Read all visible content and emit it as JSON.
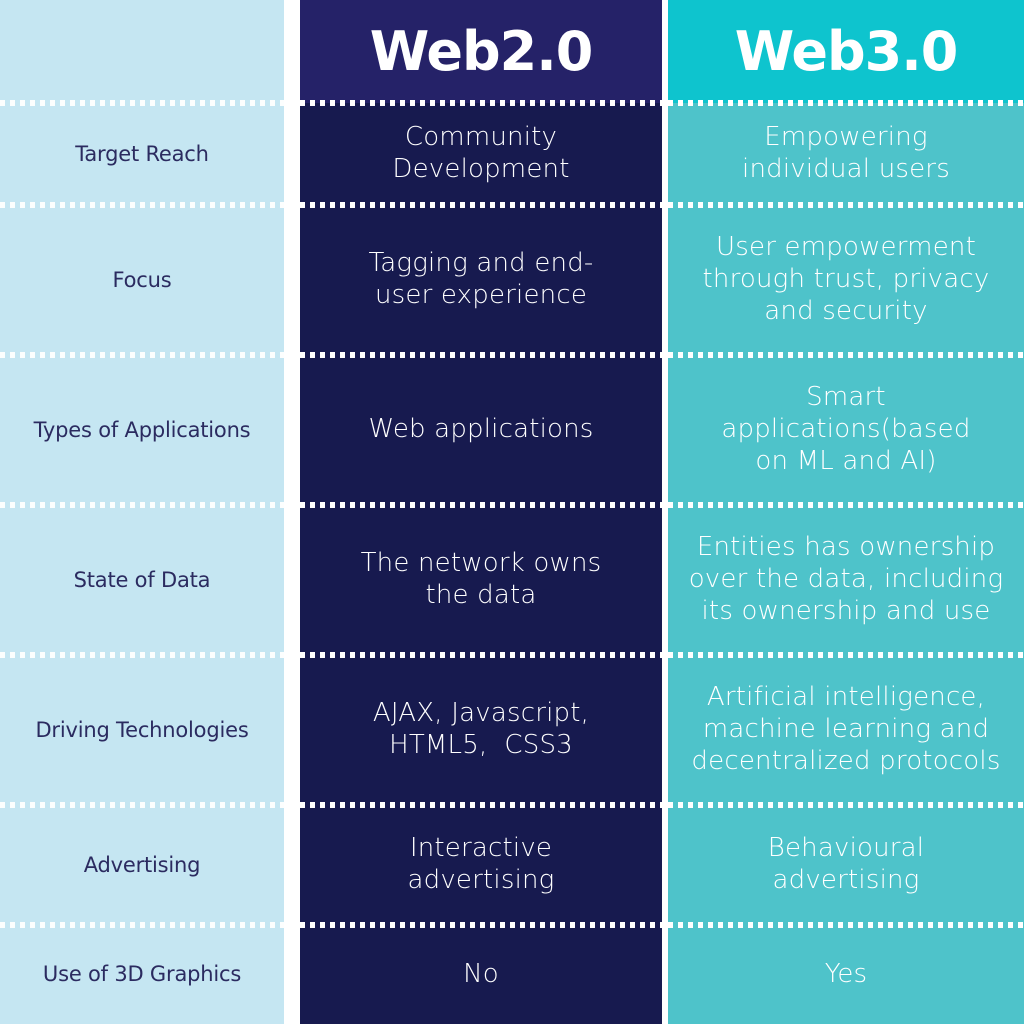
{
  "header": {
    "label_column": "",
    "web2_title": "Web2.0",
    "web3_title": "Web3.0"
  },
  "colors": {
    "label_background": "#c5e6f2",
    "label_text": "#2b2b60",
    "web2_header_background": "#252268",
    "web2_body_background": "#171a4f",
    "web3_header_background": "#0ec4ce",
    "web3_body_background": "#4ec3ca",
    "value_text": "#ffffff",
    "separator": "#ffffff"
  },
  "rows": [
    {
      "label": "Target Reach",
      "web2": "Community\nDevelopment",
      "web3": "Empowering\nindividual users"
    },
    {
      "label": "Focus",
      "web2": "Tagging and end-\nuser experience",
      "web3": "User empowerment\nthrough trust, privacy\nand security"
    },
    {
      "label": "Types of Applications",
      "web2": "Web applications",
      "web3": "Smart\napplications(based\non ML and AI)"
    },
    {
      "label": "State of Data",
      "web2": "The network owns\nthe data",
      "web3": "Entities has ownership\nover the data, including\nits ownership and use"
    },
    {
      "label": "Driving Technologies",
      "web2": "AJAX, Javascript,\nHTML5,  CSS3",
      "web3": "Artificial intelligence,\nmachine learning and\ndecentralized protocols"
    },
    {
      "label": "Advertising",
      "web2": "Interactive\nadvertising",
      "web3": "Behavioural\nadvertising"
    },
    {
      "label": "Use of 3D Graphics",
      "web2": "No",
      "web3": "Yes"
    }
  ]
}
